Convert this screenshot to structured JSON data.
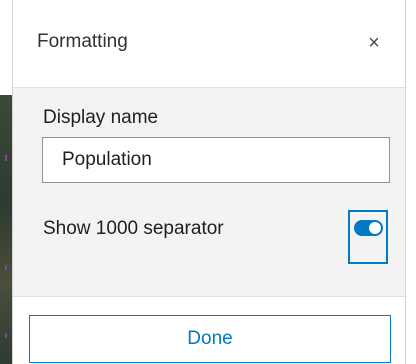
{
  "dialog": {
    "title": "Formatting",
    "close_glyph": "×",
    "close_icon": "close-icon"
  },
  "display_name": {
    "label": "Display name",
    "value": "Population"
  },
  "separator_toggle": {
    "label": "Show 1000 separator",
    "checked": true
  },
  "footer": {
    "done_label": "Done"
  },
  "colors": {
    "accent": "#007ac2",
    "body_background": "#f3f3f3",
    "text": "#1f1f1f"
  }
}
